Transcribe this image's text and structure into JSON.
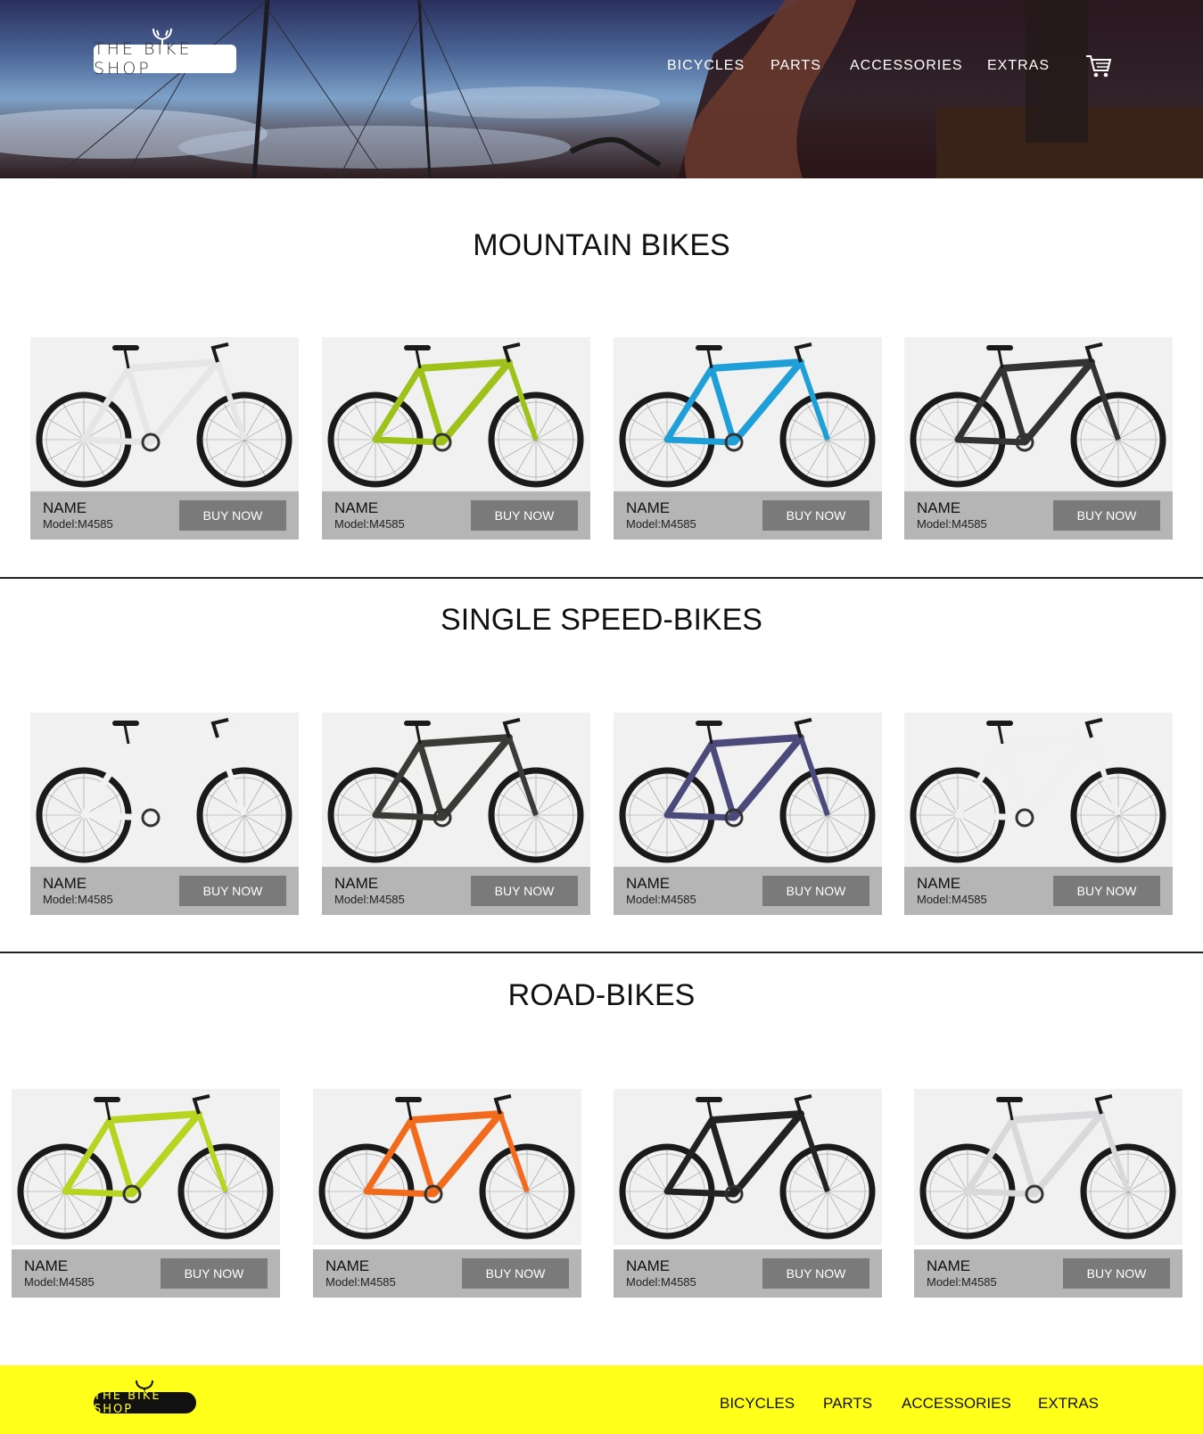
{
  "header": {
    "logo_text": "THE BIKE SHOP",
    "nav": [
      "BICYCLES",
      "PARTS",
      "ACCESSORIES",
      "EXTRAS"
    ],
    "cart_icon": "cart-icon"
  },
  "sections": [
    {
      "title": "MOUNTAIN BIKES",
      "products": [
        {
          "name": "NAME",
          "model": "Model:M4585",
          "buy_label": "BUY NOW",
          "frame_color": "#e6e6e6"
        },
        {
          "name": "NAME",
          "model": "Model:M4585",
          "buy_label": "BUY NOW",
          "frame_color": "#9fc21a"
        },
        {
          "name": "NAME",
          "model": "Model:M4585",
          "buy_label": "BUY NOW",
          "frame_color": "#1f9fd8"
        },
        {
          "name": "NAME",
          "model": "Model:M4585",
          "buy_label": "BUY NOW",
          "frame_color": "#333333"
        }
      ]
    },
    {
      "title": "SINGLE SPEED-BIKES",
      "products": [
        {
          "name": "NAME",
          "model": "Model:M4585",
          "buy_label": "BUY NOW",
          "frame_color": "#f2f2f2"
        },
        {
          "name": "NAME",
          "model": "Model:M4585",
          "buy_label": "BUY NOW",
          "frame_color": "#3a3a36"
        },
        {
          "name": "NAME",
          "model": "Model:M4585",
          "buy_label": "BUY NOW",
          "frame_color": "#4b4a7a"
        },
        {
          "name": "NAME",
          "model": "Model:M4585",
          "buy_label": "BUY NOW",
          "frame_color": "#f0f0f0"
        }
      ]
    },
    {
      "title": "ROAD-BIKES",
      "products": [
        {
          "name": "NAME",
          "model": "Model:M4585",
          "buy_label": "BUY NOW",
          "frame_color": "#b7d421"
        },
        {
          "name": "NAME",
          "model": "Model:M4585",
          "buy_label": "BUY NOW",
          "frame_color": "#f26b1d"
        },
        {
          "name": "NAME",
          "model": "Model:M4585",
          "buy_label": "BUY NOW",
          "frame_color": "#222222"
        },
        {
          "name": "NAME",
          "model": "Model:M4585",
          "buy_label": "BUY NOW",
          "frame_color": "#d9d9dc"
        }
      ]
    }
  ],
  "footer": {
    "logo_text": "THE BIKE SHOP",
    "nav": [
      "BICYCLES",
      "PARTS",
      "ACCESSORIES",
      "EXTRAS"
    ]
  },
  "colors": {
    "footer_bg": "#ffff19",
    "card_bar": "#b5b5b5",
    "buy_button": "#7a7a7a"
  }
}
